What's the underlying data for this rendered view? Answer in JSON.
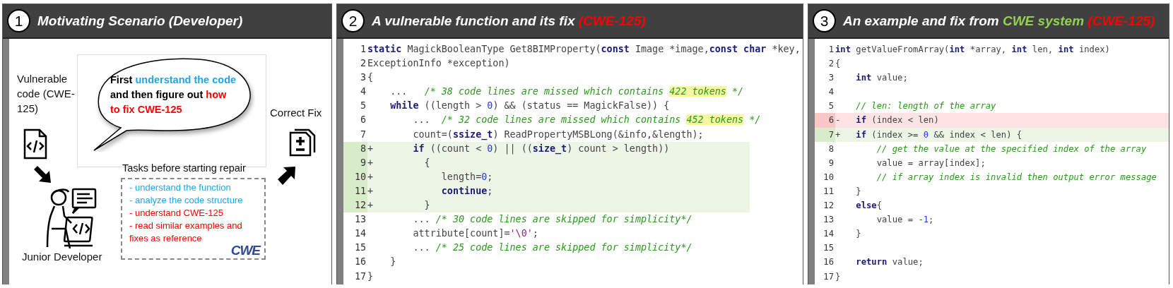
{
  "panels": [
    {
      "kind": "scenario",
      "number": "1",
      "title": [
        {
          "text": "Motivating Scenario (Developer)",
          "color": "#ffffff"
        }
      ],
      "vulnerable_label": "Vulnerable code (CWE-125)",
      "bubble": [
        {
          "text": "First ",
          "color": "#000000"
        },
        {
          "text": "understand the code",
          "color": "#1ea7e8"
        },
        {
          "text": "\nand then figure out ",
          "color": "#000000"
        },
        {
          "text": "how\nto fix CWE-125",
          "color": "#ff0000"
        }
      ],
      "tasks_title": "Tasks before starting repair",
      "tasks": [
        {
          "text": "- understand the function",
          "color": "#1ea7e8"
        },
        {
          "text": "- analyze the code structure",
          "color": "#1ea7e8"
        },
        {
          "text": "- understand CWE-125",
          "color": "#ff0000"
        },
        {
          "text": "- read similar examples and fixes as reference",
          "color": "#ff0000"
        }
      ],
      "logo": "CWE",
      "developer_label": "Junior Developer",
      "fix_label": "Correct Fix"
    },
    {
      "kind": "code",
      "number": "2",
      "title": [
        {
          "text": "A vulnerable function and its fix ",
          "color": "#ffffff"
        },
        {
          "text": "(CWE-125)",
          "color": "#ff0000"
        }
      ],
      "lines": [
        {
          "number": "1",
          "added": false,
          "removed": false,
          "tokens": [
            {
              "kind": "keyword",
              "text": "static"
            },
            {
              "kind": "plain",
              "text": " MagickBooleanType Get8BIMProperty("
            },
            {
              "kind": "keyword",
              "text": "const"
            },
            {
              "kind": "plain",
              "text": " Image *image,"
            },
            {
              "kind": "keyword",
              "text": "const"
            },
            {
              "kind": "keyword",
              "text": " char"
            },
            {
              "kind": "plain",
              "text": " *key,"
            }
          ]
        },
        {
          "number": "2",
          "added": false,
          "removed": false,
          "tokens": [
            {
              "kind": "plain",
              "text": "ExceptionInfo *exception)"
            }
          ]
        },
        {
          "number": "3",
          "added": false,
          "removed": false,
          "tokens": [
            {
              "kind": "plain",
              "text": "{"
            }
          ]
        },
        {
          "number": "4",
          "added": false,
          "removed": false,
          "tokens": [
            {
              "kind": "plain",
              "text": "    ...   "
            },
            {
              "kind": "comment",
              "text": "/* 38 code lines are missed which contains "
            },
            {
              "kind": "highlight",
              "text": "422 tokens"
            },
            {
              "kind": "comment",
              "text": " */"
            }
          ]
        },
        {
          "number": "5",
          "added": false,
          "removed": false,
          "tokens": [
            {
              "kind": "keyword",
              "text": "    while"
            },
            {
              "kind": "plain",
              "text": " ((length > "
            },
            {
              "kind": "number",
              "text": "0"
            },
            {
              "kind": "plain",
              "text": ") && (status == MagickFalse)) {"
            }
          ]
        },
        {
          "number": "6",
          "added": false,
          "removed": false,
          "tokens": [
            {
              "kind": "plain",
              "text": "        ...  "
            },
            {
              "kind": "comment",
              "text": "/* 32 code lines are missed which contains "
            },
            {
              "kind": "highlight",
              "text": "452 tokens"
            },
            {
              "kind": "comment",
              "text": " */"
            }
          ]
        },
        {
          "number": "7",
          "added": false,
          "removed": false,
          "tokens": [
            {
              "kind": "plain",
              "text": "        count=("
            },
            {
              "kind": "keyword",
              "text": "ssize_t"
            },
            {
              "kind": "plain",
              "text": ") ReadPropertyMSBLong(&info,&length);"
            }
          ]
        },
        {
          "number": "8",
          "added": true,
          "removed": false,
          "marker": "+",
          "tokens": [
            {
              "kind": "keyword",
              "text": "       if"
            },
            {
              "kind": "plain",
              "text": " ((count < "
            },
            {
              "kind": "number",
              "text": "0"
            },
            {
              "kind": "plain",
              "text": ") || (("
            },
            {
              "kind": "keyword",
              "text": "size_t"
            },
            {
              "kind": "plain",
              "text": ") count > length))"
            }
          ]
        },
        {
          "number": "9",
          "added": true,
          "removed": false,
          "marker": "+",
          "tokens": [
            {
              "kind": "plain",
              "text": "         {"
            }
          ]
        },
        {
          "number": "10",
          "added": true,
          "removed": false,
          "marker": "+",
          "tokens": [
            {
              "kind": "plain",
              "text": "            length="
            },
            {
              "kind": "number",
              "text": "0"
            },
            {
              "kind": "plain",
              "text": ";"
            }
          ]
        },
        {
          "number": "11",
          "added": true,
          "removed": false,
          "marker": "+",
          "tokens": [
            {
              "kind": "keyword",
              "text": "            continue"
            },
            {
              "kind": "plain",
              "text": ";"
            }
          ]
        },
        {
          "number": "12",
          "added": true,
          "removed": false,
          "marker": "+",
          "tokens": [
            {
              "kind": "plain",
              "text": "         }"
            }
          ]
        },
        {
          "number": "13",
          "added": false,
          "removed": false,
          "tokens": [
            {
              "kind": "plain",
              "text": "        ... "
            },
            {
              "kind": "comment",
              "text": "/* 30 code lines are skipped for simplicity*/"
            }
          ]
        },
        {
          "number": "14",
          "added": false,
          "removed": false,
          "tokens": [
            {
              "kind": "plain",
              "text": "        attribute[count]="
            },
            {
              "kind": "string",
              "text": "'\\0'"
            },
            {
              "kind": "plain",
              "text": ";"
            }
          ]
        },
        {
          "number": "15",
          "added": false,
          "removed": false,
          "tokens": [
            {
              "kind": "plain",
              "text": "        ... "
            },
            {
              "kind": "comment",
              "text": "/* 25 code lines are skipped for simplicity*/"
            }
          ]
        },
        {
          "number": "16",
          "added": false,
          "removed": false,
          "tokens": [
            {
              "kind": "plain",
              "text": "    }"
            }
          ]
        },
        {
          "number": "17",
          "added": false,
          "removed": false,
          "tokens": [
            {
              "kind": "plain",
              "text": "}"
            }
          ]
        }
      ]
    },
    {
      "kind": "code",
      "number": "3",
      "title": [
        {
          "text": "An example and fix from ",
          "color": "#ffffff"
        },
        {
          "text": "CWE system ",
          "color": "#92d050"
        },
        {
          "text": "(CWE-125)",
          "color": "#ff0000"
        }
      ],
      "lines": [
        {
          "number": "1",
          "added": false,
          "removed": false,
          "tokens": [
            {
              "kind": "keyword",
              "text": "int"
            },
            {
              "kind": "plain",
              "text": " getValueFromArray("
            },
            {
              "kind": "keyword",
              "text": "int"
            },
            {
              "kind": "plain",
              "text": " *array, "
            },
            {
              "kind": "keyword",
              "text": "int"
            },
            {
              "kind": "plain",
              "text": " len, "
            },
            {
              "kind": "keyword",
              "text": "int"
            },
            {
              "kind": "plain",
              "text": " index)"
            }
          ]
        },
        {
          "number": "2",
          "added": false,
          "removed": false,
          "tokens": [
            {
              "kind": "plain",
              "text": "{"
            }
          ]
        },
        {
          "number": "3",
          "added": false,
          "removed": false,
          "tokens": [
            {
              "kind": "keyword",
              "text": "    int"
            },
            {
              "kind": "plain",
              "text": " value;"
            }
          ]
        },
        {
          "number": "4",
          "added": false,
          "removed": false
        },
        {
          "number": "5",
          "added": false,
          "removed": false,
          "tokens": [
            {
              "kind": "comment",
              "text": "    // len: length of the array"
            }
          ]
        },
        {
          "number": "6",
          "added": false,
          "removed": true,
          "marker": "-",
          "tokens": [
            {
              "kind": "keyword",
              "text": "   if"
            },
            {
              "kind": "plain",
              "text": " (index < len)"
            }
          ]
        },
        {
          "number": "7",
          "added": true,
          "removed": false,
          "marker": "+",
          "tokens": [
            {
              "kind": "keyword",
              "text": "   if"
            },
            {
              "kind": "plain",
              "text": " (index >= "
            },
            {
              "kind": "number",
              "text": "0"
            },
            {
              "kind": "plain",
              "text": " && index < len) {"
            }
          ]
        },
        {
          "number": "8",
          "added": false,
          "removed": false,
          "tokens": [
            {
              "kind": "comment",
              "text": "        // get the value at the specified index of the array"
            }
          ]
        },
        {
          "number": "9",
          "added": false,
          "removed": false,
          "tokens": [
            {
              "kind": "plain",
              "text": "        value = array[index];"
            }
          ]
        },
        {
          "number": "10",
          "added": false,
          "removed": false,
          "tokens": [
            {
              "kind": "comment",
              "text": "        // if array index is invalid then output error message"
            }
          ]
        },
        {
          "number": "11",
          "added": false,
          "removed": false,
          "tokens": [
            {
              "kind": "plain",
              "text": "    }"
            }
          ]
        },
        {
          "number": "12",
          "added": false,
          "removed": false,
          "tokens": [
            {
              "kind": "keyword",
              "text": "    else"
            },
            {
              "kind": "plain",
              "text": "{"
            }
          ]
        },
        {
          "number": "13",
          "added": false,
          "removed": false,
          "tokens": [
            {
              "kind": "plain",
              "text": "        value = -"
            },
            {
              "kind": "number",
              "text": "1"
            },
            {
              "kind": "plain",
              "text": ";"
            }
          ]
        },
        {
          "number": "14",
          "added": false,
          "removed": false,
          "tokens": [
            {
              "kind": "plain",
              "text": "    }"
            }
          ]
        },
        {
          "number": "15",
          "added": false,
          "removed": false
        },
        {
          "number": "16",
          "added": false,
          "removed": false,
          "tokens": [
            {
              "kind": "keyword",
              "text": "    return"
            },
            {
              "kind": "plain",
              "text": " value;"
            }
          ]
        },
        {
          "number": "17",
          "added": false,
          "removed": false,
          "tokens": [
            {
              "kind": "plain",
              "text": "}"
            }
          ]
        }
      ]
    }
  ]
}
